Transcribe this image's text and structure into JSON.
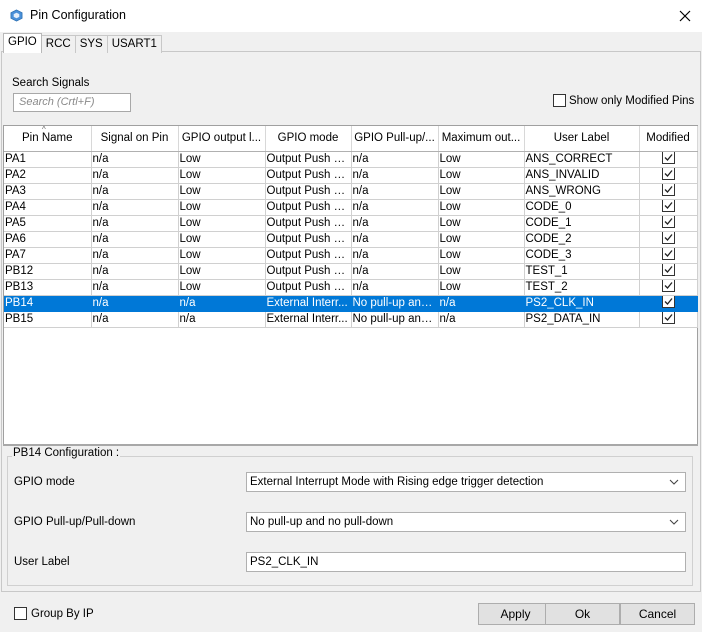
{
  "window": {
    "title": "Pin Configuration",
    "app_icon": "cube-icon",
    "close_icon": "close-icon"
  },
  "tabs": [
    {
      "label": "GPIO",
      "active": true
    },
    {
      "label": "RCC",
      "active": false
    },
    {
      "label": "SYS",
      "active": false
    },
    {
      "label": "USART1",
      "active": false
    }
  ],
  "search": {
    "label": "Search Signals",
    "placeholder": "Search (Crtl+F)"
  },
  "show_modified": {
    "label": "Show only Modified Pins",
    "checked": false
  },
  "table": {
    "columns": [
      "Pin Name",
      "Signal on Pin",
      "GPIO output l...",
      "GPIO mode",
      "GPIO Pull-up/...",
      "Maximum out...",
      "User Label",
      "Modified"
    ],
    "rows": [
      {
        "pin": "PA1",
        "signal": "n/a",
        "output": "Low",
        "mode": "Output Push Pull",
        "pull": "n/a",
        "speed": "Low",
        "label": "ANS_CORRECT",
        "modified": true,
        "selected": false
      },
      {
        "pin": "PA2",
        "signal": "n/a",
        "output": "Low",
        "mode": "Output Push Pull",
        "pull": "n/a",
        "speed": "Low",
        "label": "ANS_INVALID",
        "modified": true,
        "selected": false
      },
      {
        "pin": "PA3",
        "signal": "n/a",
        "output": "Low",
        "mode": "Output Push Pull",
        "pull": "n/a",
        "speed": "Low",
        "label": "ANS_WRONG",
        "modified": true,
        "selected": false
      },
      {
        "pin": "PA4",
        "signal": "n/a",
        "output": "Low",
        "mode": "Output Push Pull",
        "pull": "n/a",
        "speed": "Low",
        "label": "CODE_0",
        "modified": true,
        "selected": false
      },
      {
        "pin": "PA5",
        "signal": "n/a",
        "output": "Low",
        "mode": "Output Push Pull",
        "pull": "n/a",
        "speed": "Low",
        "label": "CODE_1",
        "modified": true,
        "selected": false
      },
      {
        "pin": "PA6",
        "signal": "n/a",
        "output": "Low",
        "mode": "Output Push Pull",
        "pull": "n/a",
        "speed": "Low",
        "label": "CODE_2",
        "modified": true,
        "selected": false
      },
      {
        "pin": "PA7",
        "signal": "n/a",
        "output": "Low",
        "mode": "Output Push Pull",
        "pull": "n/a",
        "speed": "Low",
        "label": "CODE_3",
        "modified": true,
        "selected": false
      },
      {
        "pin": "PB12",
        "signal": "n/a",
        "output": "Low",
        "mode": "Output Push Pull",
        "pull": "n/a",
        "speed": "Low",
        "label": "TEST_1",
        "modified": true,
        "selected": false
      },
      {
        "pin": "PB13",
        "signal": "n/a",
        "output": "Low",
        "mode": "Output Push Pull",
        "pull": "n/a",
        "speed": "Low",
        "label": "TEST_2",
        "modified": true,
        "selected": false
      },
      {
        "pin": "PB14",
        "signal": "n/a",
        "output": "n/a",
        "mode": "External Interr...",
        "pull": "No pull-up and ...",
        "speed": "n/a",
        "label": "PS2_CLK_IN",
        "modified": true,
        "selected": true
      },
      {
        "pin": "PB15",
        "signal": "n/a",
        "output": "n/a",
        "mode": "External Interr...",
        "pull": "No pull-up and ...",
        "speed": "n/a",
        "label": "PS2_DATA_IN",
        "modified": true,
        "selected": false
      }
    ]
  },
  "config": {
    "title": "PB14 Configuration :",
    "gpio_mode_label": "GPIO mode",
    "gpio_mode_value": "External Interrupt Mode with Rising edge trigger detection",
    "pull_label": "GPIO Pull-up/Pull-down",
    "pull_value": "No pull-up and no pull-down",
    "user_label_label": "User Label",
    "user_label_value": "PS2_CLK_IN"
  },
  "footer": {
    "group_by_ip": "Group By IP",
    "group_by_checked": false,
    "apply": "Apply",
    "ok": "Ok",
    "cancel": "Cancel"
  },
  "colors": {
    "selection": "#0078d7",
    "dialog_bg": "#f0f0f0",
    "app_icon": "#4a90d9"
  }
}
